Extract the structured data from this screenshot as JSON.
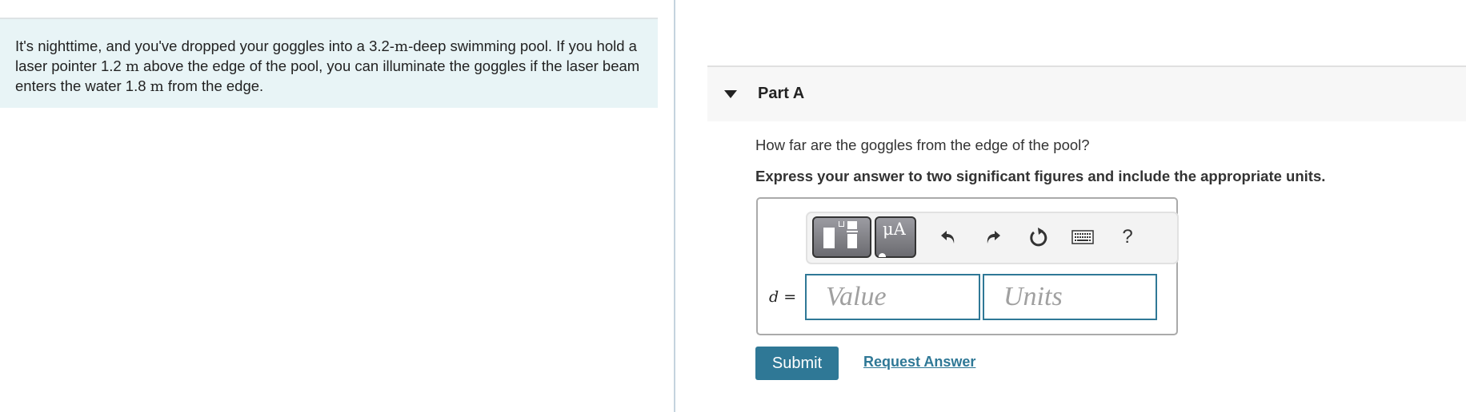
{
  "problem": {
    "segments": [
      {
        "text": "It's nighttime, and you've dropped your goggles into a 3.2-",
        "unit": false
      },
      {
        "text": "m",
        "unit": true
      },
      {
        "text": "-deep swimming pool. If you hold a laser pointer 1.2 ",
        "unit": false
      },
      {
        "text": "m",
        "unit": true
      },
      {
        "text": " above the edge of the pool, you can illuminate the goggles if the laser beam enters the water 1.8 ",
        "unit": false
      },
      {
        "text": "m",
        "unit": true
      },
      {
        "text": " from the edge.",
        "unit": false
      }
    ]
  },
  "part": {
    "title": "Part A",
    "expanded": true,
    "question": "How far are the goggles from the edge of the pool?",
    "instruction": "Express your answer to two significant figures and include the appropriate units."
  },
  "toolbar": {
    "templates_icon": "templates-icon",
    "symbols_label": "μA",
    "undo_icon": "undo-icon",
    "redo_icon": "redo-icon",
    "reset_icon": "reset-icon",
    "keyboard_icon": "keyboard-icon",
    "help_label": "?"
  },
  "answer": {
    "variable": "d",
    "equals": "=",
    "value": "",
    "value_placeholder": "Value",
    "units": "",
    "units_placeholder": "Units"
  },
  "actions": {
    "submit_label": "Submit",
    "request_answer_label": "Request Answer"
  },
  "colors": {
    "accent": "#2f7896",
    "problem_bg": "#e8f4f6",
    "header_bg": "#f7f7f7"
  }
}
